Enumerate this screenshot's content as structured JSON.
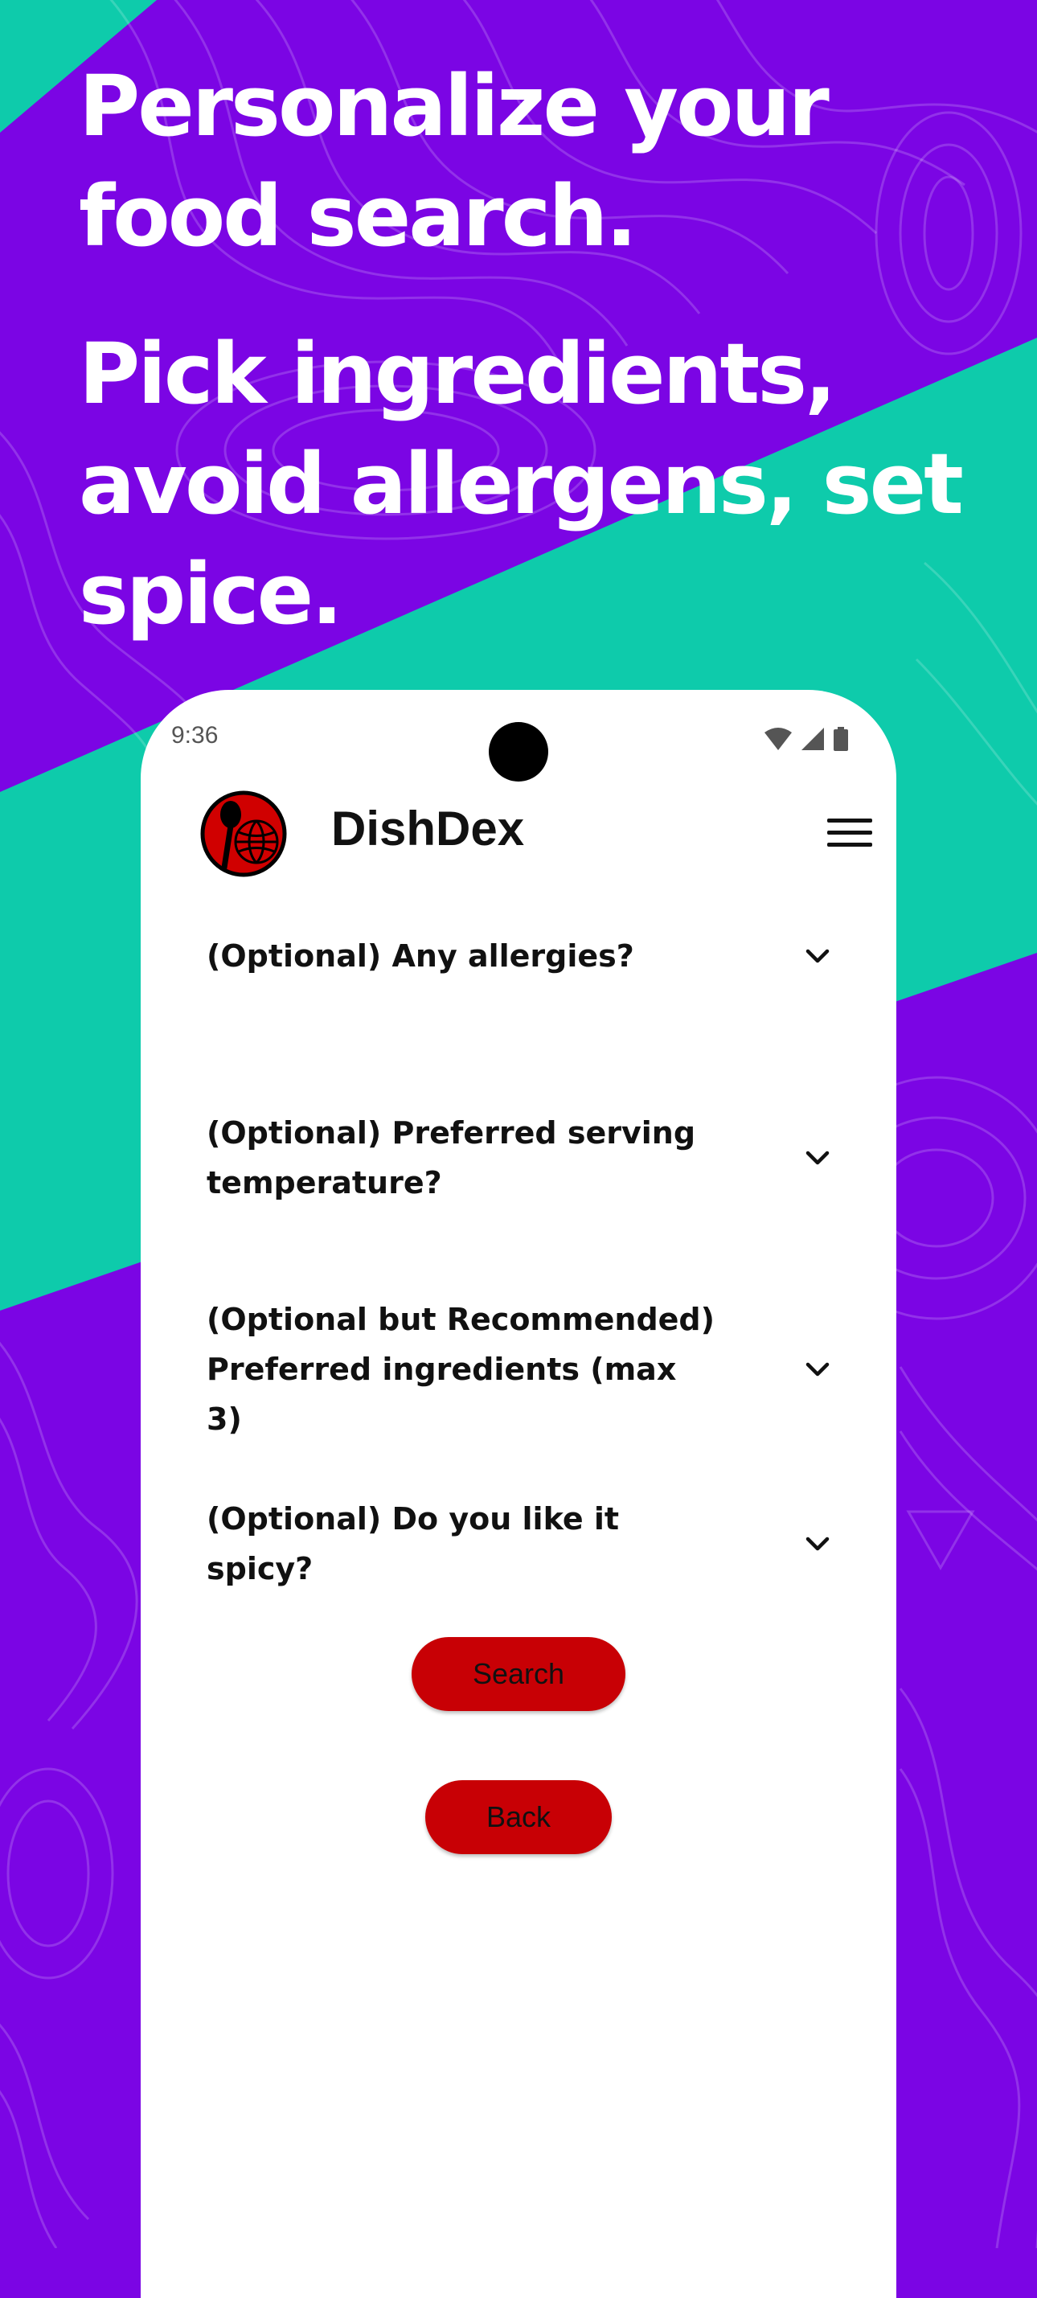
{
  "marketing": {
    "headline_1": "Personalize your food search.",
    "headline_2": "Pick ingredients, avoid allergens, set spice."
  },
  "colors": {
    "background_purple": "#7b05e4",
    "accent_teal": "#0ecbab",
    "button_red": "#c80005",
    "phone_white": "#ffffff"
  },
  "status_bar": {
    "time": "9:36",
    "icons": [
      "wifi-icon",
      "signal-icon",
      "battery-icon"
    ]
  },
  "app_bar": {
    "title": "DishDex",
    "logo_icon": "dishdex-logo",
    "menu_icon": "hamburger-menu-icon"
  },
  "questions": [
    {
      "label": "(Optional) Any allergies?",
      "icon": "chevron-down-icon"
    },
    {
      "label": "(Optional) Preferred serving temperature?",
      "icon": "chevron-down-icon"
    },
    {
      "label": "(Optional but Recommended) Preferred ingredients (max 3)",
      "icon": "chevron-down-icon"
    },
    {
      "label": "(Optional) Do you like it spicy?",
      "icon": "chevron-down-icon"
    }
  ],
  "buttons": {
    "search_label": "Search",
    "back_label": "Back"
  }
}
